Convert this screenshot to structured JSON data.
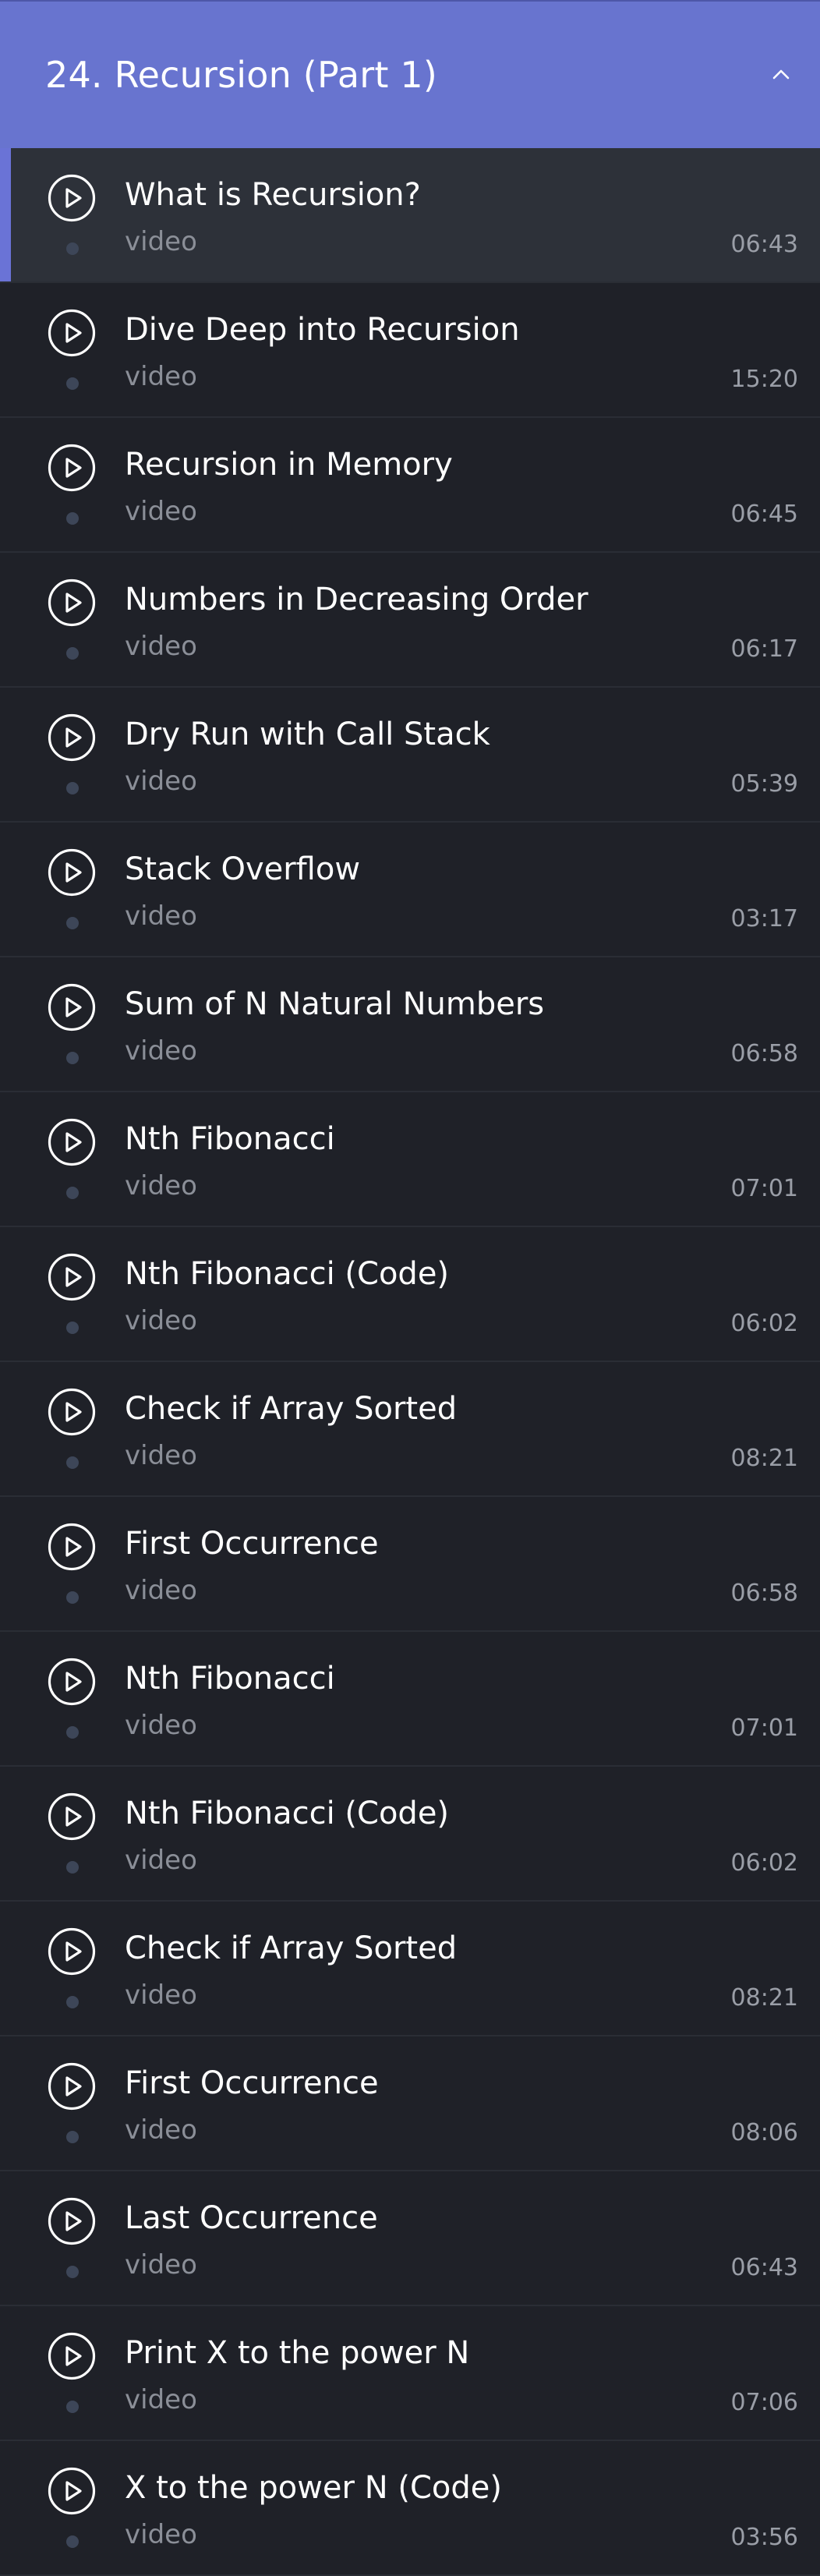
{
  "section": {
    "title": "24. Recursion (Part 1)",
    "expanded": true,
    "color": "#6874cf"
  },
  "lessons": [
    {
      "title": "What is Recursion?",
      "type": "video",
      "duration": "06:43",
      "active": true
    },
    {
      "title": "Dive Deep into Recursion",
      "type": "video",
      "duration": "15:20",
      "active": false
    },
    {
      "title": "Recursion in Memory",
      "type": "video",
      "duration": "06:45",
      "active": false
    },
    {
      "title": "Numbers in Decreasing Order",
      "type": "video",
      "duration": "06:17",
      "active": false
    },
    {
      "title": "Dry Run with Call Stack",
      "type": "video",
      "duration": "05:39",
      "active": false
    },
    {
      "title": "Stack Overflow",
      "type": "video",
      "duration": "03:17",
      "active": false
    },
    {
      "title": "Sum of N Natural Numbers",
      "type": "video",
      "duration": "06:58",
      "active": false
    },
    {
      "title": "Nth Fibonacci",
      "type": "video",
      "duration": "07:01",
      "active": false
    },
    {
      "title": "Nth Fibonacci (Code)",
      "type": "video",
      "duration": "06:02",
      "active": false
    },
    {
      "title": "Check if Array Sorted",
      "type": "video",
      "duration": "08:21",
      "active": false
    },
    {
      "title": "First Occurrence",
      "type": "video",
      "duration": "06:58",
      "active": false
    },
    {
      "title": "Nth Fibonacci",
      "type": "video",
      "duration": "07:01",
      "active": false
    },
    {
      "title": "Nth Fibonacci (Code)",
      "type": "video",
      "duration": "06:02",
      "active": false
    },
    {
      "title": "Check if Array Sorted",
      "type": "video",
      "duration": "08:21",
      "active": false
    },
    {
      "title": "First Occurrence",
      "type": "video",
      "duration": "08:06",
      "active": false
    },
    {
      "title": "Last Occurrence",
      "type": "video",
      "duration": "06:43",
      "active": false
    },
    {
      "title": "Print X to the power N",
      "type": "video",
      "duration": "07:06",
      "active": false
    },
    {
      "title": "X to the power N (Code)",
      "type": "video",
      "duration": "03:56",
      "active": false
    }
  ],
  "icons": {
    "lesson": "play-circle-icon",
    "header": "chevron-up-icon"
  }
}
